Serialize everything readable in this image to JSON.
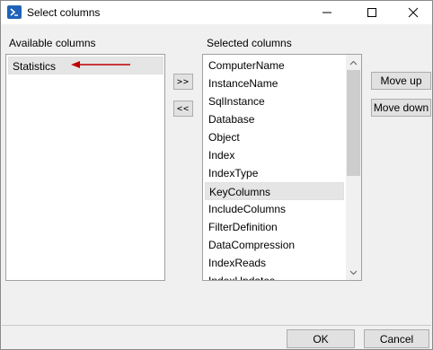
{
  "window": {
    "title": "Select columns",
    "controls": {
      "minimize": "minimize",
      "maximize": "maximize",
      "close": "close"
    }
  },
  "available": {
    "label": "Available columns",
    "items": [
      "Statistics"
    ]
  },
  "selected": {
    "label": "Selected columns",
    "items": [
      "ComputerName",
      "InstanceName",
      "SqlInstance",
      "Database",
      "Object",
      "Index",
      "IndexType",
      "KeyColumns",
      "IncludeColumns",
      "FilterDefinition",
      "DataCompression",
      "IndexReads",
      "IndexUpdates"
    ],
    "highlighted_item": "KeyColumns"
  },
  "buttons": {
    "add": ">>",
    "remove": "<<",
    "move_up": "Move up",
    "move_down": "Move down",
    "ok": "OK",
    "cancel": "Cancel"
  },
  "colors": {
    "annotation_arrow": "#c00000",
    "app_icon": "#1f63b8",
    "selection": "#e5e5e5"
  }
}
